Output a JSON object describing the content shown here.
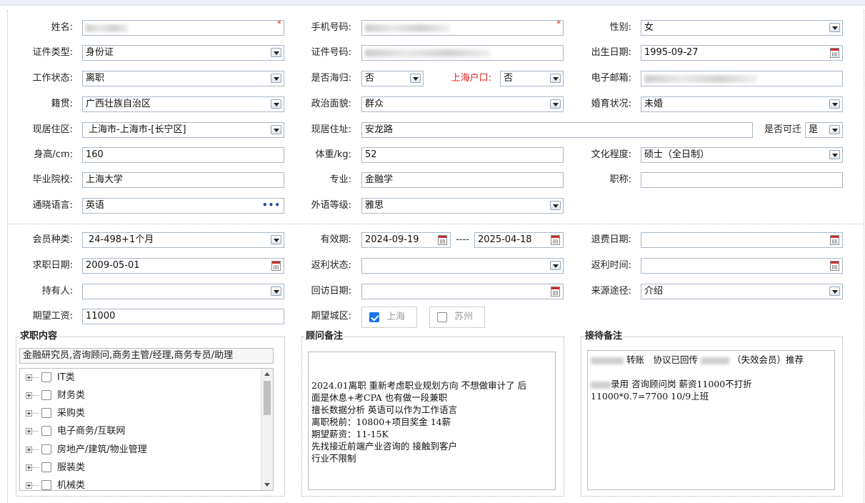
{
  "form": {
    "name_label": "姓名:",
    "phone_label": "手机号码:",
    "gender_label": "性别:",
    "gender_value": "女",
    "idtype_label": "证件类型:",
    "idtype_value": "身份证",
    "idno_label": "证件号码:",
    "birth_label": "出生日期:",
    "birth_value": "1995-09-27",
    "workstatus_label": "工作状态:",
    "workstatus_value": "离职",
    "overseas_label": "是否海归:",
    "overseas_value": "否",
    "hukou_label": "上海户口:",
    "hukou_value": "否",
    "email_label": "电子邮箱:",
    "origin_label": "籍贯:",
    "origin_value": "广西壮族自治区",
    "political_label": "政治面貌:",
    "political_value": "群众",
    "marital_label": "婚育状况:",
    "marital_value": "未婚",
    "district_label": "现居住区:",
    "district_value": "上海市-上海市-[长宁区]",
    "address_label": "现居住址:",
    "address_value": "安龙路",
    "relocate_label": "是否可迁",
    "relocate_value": "是",
    "height_label": "身高/cm:",
    "height_value": "160",
    "weight_label": "体重/kg:",
    "weight_value": "52",
    "education_label": "文化程度:",
    "education_value": "硕士（全日制）",
    "school_label": "毕业院校:",
    "school_value": "上海大学",
    "major_label": "专业:",
    "major_value": "金融学",
    "title_label": "职称:",
    "title_value": "",
    "language_label": "通晓语言:",
    "language_value": "英语",
    "langlevel_label": "外语等级:",
    "langlevel_value": "雅思",
    "required_mark": "*"
  },
  "member": {
    "type_label": "会员种类:",
    "type_value": "24-498+1个月",
    "valid_label": "有效期:",
    "valid_from": "2024-09-19",
    "valid_sep": "----",
    "valid_to": "2025-04-18",
    "refund_label": "退费日期:",
    "refund_value": "",
    "jobdate_label": "求职日期:",
    "jobdate_value": "2009-05-01",
    "rebate_label": "返利状态:",
    "rebate_value": "",
    "rebatetime_label": "返利时间:",
    "rebatetime_value": "",
    "holder_label": "持有人:",
    "holder_value": "",
    "visit_label": "回访日期:",
    "visit_value": "",
    "source_label": "来源途径:",
    "source_value": "介绍",
    "salary_label": "期望工资:",
    "salary_value": "11000",
    "city_label": "期望城区:",
    "city_options": [
      {
        "label": "上海",
        "checked": true
      },
      {
        "label": "苏州",
        "checked": false
      }
    ]
  },
  "job": {
    "legend": "求职内容",
    "selected": "金融研究员,咨询顾问,商务主管/经理,商务专员/助理",
    "categories": [
      "IT类",
      "财务类",
      "采购类",
      "电子商务/互联网",
      "房地产/建筑/物业管理",
      "服装类",
      "机械类"
    ]
  },
  "advisor": {
    "legend": "顾问备注",
    "lines": [
      "",
      "",
      "2024.01离职 重新考虑职业规划方向 不想做审计了 后",
      "面是休息+考CPA 也有做一段兼职",
      "擅长数据分析 英语可以作为工作语言",
      "离职税前：10800+项目奖金 14薪",
      "期望薪资：11-15K",
      "先找接近前端产业咨询的 接触到客户",
      "行业不限制"
    ]
  },
  "reception": {
    "legend": "接待备注",
    "line1_a": "转账　协议已回传",
    "line1_b": "（失效会员）推荐",
    "line2": "录用 咨询顾问岗 薪资11000不打折",
    "line3": "11000*0.7=7700 10/9上班"
  }
}
